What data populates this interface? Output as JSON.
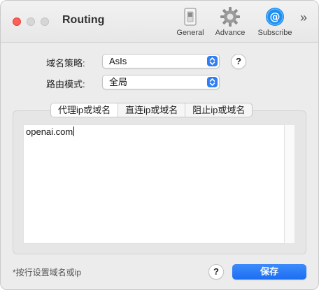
{
  "window": {
    "title": "Routing"
  },
  "toolbar": {
    "items": [
      {
        "label": "General",
        "icon": "general-switch-icon"
      },
      {
        "label": "Advance",
        "icon": "gear-icon"
      },
      {
        "label": "Subscribe",
        "icon": "at-sign-icon"
      }
    ],
    "overflow": "»"
  },
  "domain_strategy": {
    "label": "域名策略:",
    "value": "AsIs"
  },
  "routing_mode": {
    "label": "路由模式:",
    "value": "全局"
  },
  "help_label": "?",
  "tabs": {
    "items": [
      {
        "label": "代理ip或域名",
        "selected": true
      },
      {
        "label": "直连ip或域名",
        "selected": false
      },
      {
        "label": "阻止ip或域名",
        "selected": false
      }
    ]
  },
  "editor": {
    "content": "openai.com"
  },
  "footer": {
    "hint": "*按行设置域名或ip",
    "help_label": "?",
    "save_label": "保存"
  },
  "colors": {
    "accent": "#2f7ef6",
    "close": "#fe5f57"
  }
}
